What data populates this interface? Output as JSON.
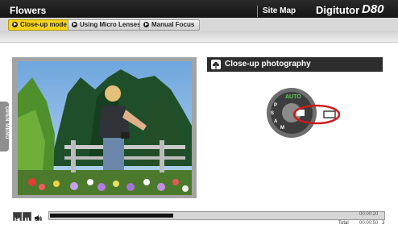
{
  "header": {
    "title": "Flowers",
    "site_map": "Site Map",
    "brand": "Digitutor",
    "model": "D80"
  },
  "tabs": [
    {
      "label": "Close-up mode",
      "active": true
    },
    {
      "label": "Using Micro Lenses",
      "active": false
    },
    {
      "label": "Manual Focus",
      "active": false
    }
  ],
  "side_menu": {
    "label": "OPEN MENU"
  },
  "section": {
    "title": "Close-up photography"
  },
  "dial": {
    "highlight_color": "#cc1b1b"
  },
  "player": {
    "volume_label": "ON",
    "progress": 0.37,
    "current_time": "00:00:20",
    "total_label": "Total",
    "total_time": "00:00:50",
    "page": "3"
  },
  "colors": {
    "header_bg": "#1a1a1a",
    "active_tab": "#f6d21b",
    "heading_bg": "#2d2d2d"
  }
}
